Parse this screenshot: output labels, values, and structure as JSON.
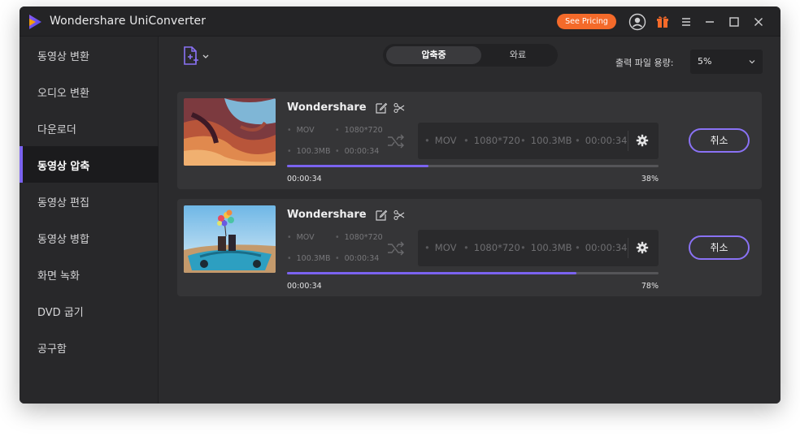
{
  "window": {
    "title": "Wondershare UniConverter",
    "pricing_label": "See Pricing"
  },
  "sidebar": {
    "items": [
      {
        "label": "동영상 변환",
        "active": false
      },
      {
        "label": "오디오 변환",
        "active": false
      },
      {
        "label": "다운로더",
        "active": false
      },
      {
        "label": "동영상 압축",
        "active": true
      },
      {
        "label": "동영상 편집",
        "active": false
      },
      {
        "label": "동영상 병합",
        "active": false
      },
      {
        "label": "화면 녹화",
        "active": false
      },
      {
        "label": "DVD 굽기",
        "active": false
      },
      {
        "label": "공구함",
        "active": false
      }
    ]
  },
  "toolbar": {
    "tab_compressing": "압축중",
    "tab_done": "와료",
    "output_size_label": "출력 파일 용량:",
    "output_size_value": "5%"
  },
  "tasks": [
    {
      "name": "Wondershare",
      "src": {
        "format": "MOV",
        "resolution": "1080*720",
        "size": "100.3MB",
        "duration": "00:00:34"
      },
      "target": {
        "format": "MOV",
        "resolution": "1080*720",
        "size": "100.3MB",
        "duration": "00:00:34"
      },
      "elapsed": "00:00:34",
      "progress_label": "38%",
      "progress": 0.38,
      "cancel_label": "취소"
    },
    {
      "name": "Wondershare",
      "src": {
        "format": "MOV",
        "resolution": "1080*720",
        "size": "100.3MB",
        "duration": "00:00:34"
      },
      "target": {
        "format": "MOV",
        "resolution": "1080*720",
        "size": "100.3MB",
        "duration": "00:00:34"
      },
      "elapsed": "00:00:34",
      "progress_label": "78%",
      "progress": 0.78,
      "cancel_label": "취소"
    }
  ],
  "colors": {
    "accent": "#7b63f0",
    "pricing": "#f46a2a",
    "background": "#2b2b2d"
  }
}
